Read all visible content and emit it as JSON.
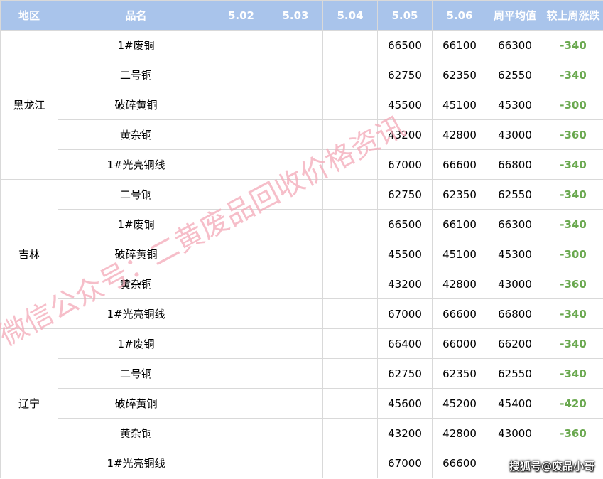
{
  "headers": [
    "地区",
    "品名",
    "5.02",
    "5.03",
    "5.04",
    "5.05",
    "5.06",
    "周平均值",
    "较上周涨跌"
  ],
  "groups": [
    {
      "region": "黑龙江",
      "rows": [
        {
          "name": "1#废铜",
          "d502": "",
          "d503": "",
          "d504": "",
          "d505": "66500",
          "d506": "66100",
          "avg": "66300",
          "change": "-340"
        },
        {
          "name": "二号铜",
          "d502": "",
          "d503": "",
          "d504": "",
          "d505": "62750",
          "d506": "62350",
          "avg": "62550",
          "change": "-340"
        },
        {
          "name": "破碎黄铜",
          "d502": "",
          "d503": "",
          "d504": "",
          "d505": "45500",
          "d506": "45100",
          "avg": "45300",
          "change": "-300"
        },
        {
          "name": "黄杂铜",
          "d502": "",
          "d503": "",
          "d504": "",
          "d505": "43200",
          "d506": "42800",
          "avg": "43000",
          "change": "-360"
        },
        {
          "name": "1#光亮铜线",
          "d502": "",
          "d503": "",
          "d504": "",
          "d505": "67000",
          "d506": "66600",
          "avg": "66800",
          "change": "-340"
        }
      ]
    },
    {
      "region": "吉林",
      "rows": [
        {
          "name": "二号铜",
          "d502": "",
          "d503": "",
          "d504": "",
          "d505": "62750",
          "d506": "62350",
          "avg": "62550",
          "change": "-340"
        },
        {
          "name": "1#废铜",
          "d502": "",
          "d503": "",
          "d504": "",
          "d505": "66500",
          "d506": "66100",
          "avg": "66300",
          "change": "-340"
        },
        {
          "name": "破碎黄铜",
          "d502": "",
          "d503": "",
          "d504": "",
          "d505": "45500",
          "d506": "45100",
          "avg": "45300",
          "change": "-300"
        },
        {
          "name": "黄杂铜",
          "d502": "",
          "d503": "",
          "d504": "",
          "d505": "43200",
          "d506": "42800",
          "avg": "43000",
          "change": "-360"
        },
        {
          "name": "1#光亮铜线",
          "d502": "",
          "d503": "",
          "d504": "",
          "d505": "67000",
          "d506": "66600",
          "avg": "66800",
          "change": "-340"
        }
      ]
    },
    {
      "region": "辽宁",
      "rows": [
        {
          "name": "1#废铜",
          "d502": "",
          "d503": "",
          "d504": "",
          "d505": "66400",
          "d506": "66000",
          "avg": "66200",
          "change": "-340"
        },
        {
          "name": "二号铜",
          "d502": "",
          "d503": "",
          "d504": "",
          "d505": "62750",
          "d506": "62350",
          "avg": "62550",
          "change": "-340"
        },
        {
          "name": "破碎黄铜",
          "d502": "",
          "d503": "",
          "d504": "",
          "d505": "45600",
          "d506": "45200",
          "avg": "45400",
          "change": "-420"
        },
        {
          "name": "黄杂铜",
          "d502": "",
          "d503": "",
          "d504": "",
          "d505": "43200",
          "d506": "42800",
          "avg": "43000",
          "change": "-360"
        },
        {
          "name": "1#光亮铜线",
          "d502": "",
          "d503": "",
          "d504": "",
          "d505": "67000",
          "d506": "66600",
          "avg": "",
          "change": ""
        }
      ]
    }
  ],
  "watermark": {
    "text1": "微信公众号：",
    "text2": "二黄废品回收价格资讯"
  },
  "credit": "搜狐号@废品小哥",
  "colors": {
    "header_bg": "#a9c4eb",
    "change_green": "#6aa84f",
    "watermark": "#f4a9b8"
  }
}
